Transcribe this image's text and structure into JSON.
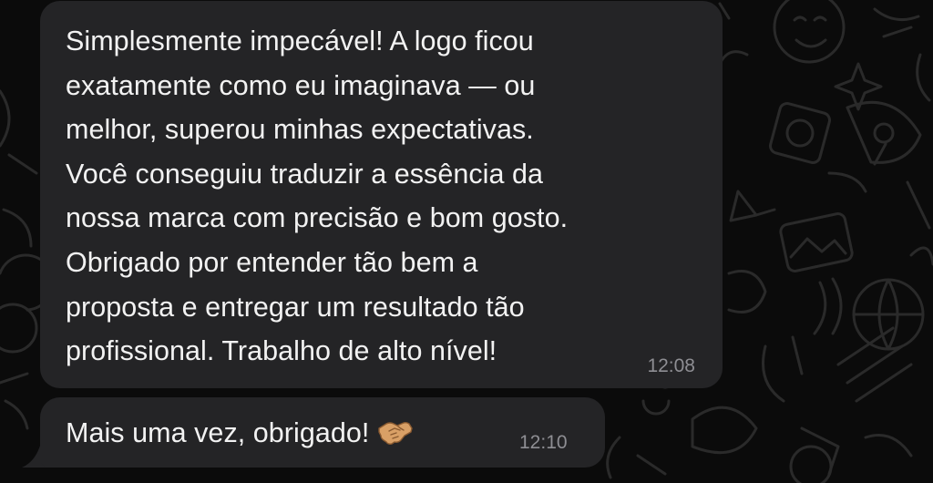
{
  "chat": {
    "messages": [
      {
        "text": "Simplesmente impecável! A logo ficou\nexatamente como eu imaginava — ou\nmelhor, superou minhas expectativas.\nVocê conseguiu traduzir a essência da\nnossa marca com precisão e bom gosto.\nObrigado por entender tão bem a\nproposta e entregar um resultado tão\nprofissional. Trabalho de alto nível!",
        "time": "12:08"
      },
      {
        "text": "Mais uma vez, obrigado!",
        "emoji": "handshake-emoji",
        "time": "12:10"
      }
    ]
  },
  "colors": {
    "background": "#0b0b0b",
    "bubble": "#242426",
    "text": "#f2f2f2",
    "timestamp": "#8e8e93",
    "doodle": "#2a2a2a"
  }
}
